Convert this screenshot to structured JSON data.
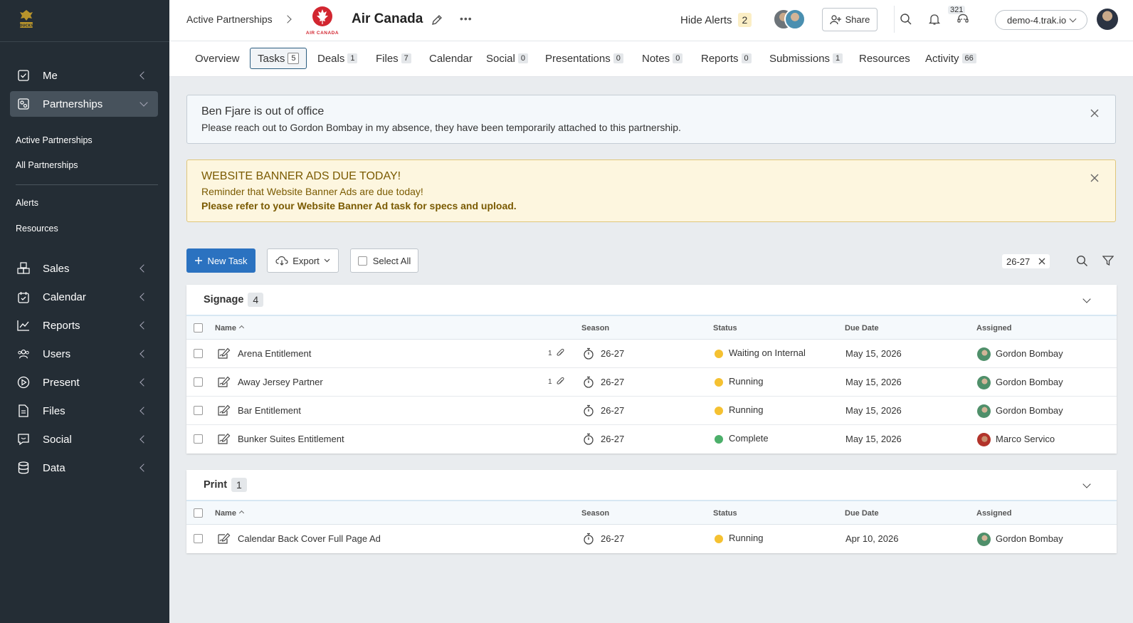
{
  "sidebar": {
    "logo_text": "DUCKS",
    "items": [
      {
        "label": "Me",
        "icon": "check-square-icon"
      },
      {
        "label": "Partnerships",
        "icon": "partnership-icon"
      },
      {
        "label": "Sales",
        "icon": "boxes-icon"
      },
      {
        "label": "Calendar",
        "icon": "calendar-check-icon"
      },
      {
        "label": "Reports",
        "icon": "chart-icon"
      },
      {
        "label": "Users",
        "icon": "users-icon"
      },
      {
        "label": "Present",
        "icon": "play-icon"
      },
      {
        "label": "Files",
        "icon": "file-icon"
      },
      {
        "label": "Social",
        "icon": "chat-icon"
      },
      {
        "label": "Data",
        "icon": "database-icon"
      }
    ],
    "subitems": {
      "active_partnerships": "Active Partnerships",
      "all_partnerships": "All Partnerships",
      "alerts": "Alerts",
      "resources": "Resources"
    }
  },
  "topbar": {
    "breadcrumb": "Active Partnerships",
    "logo_text": "AIR CANADA",
    "title": "Air Canada",
    "hide_alerts_label": "Hide Alerts",
    "hide_alerts_count": "2",
    "share_label": "Share",
    "notifications_count": "321",
    "domain": "demo-4.trak.io"
  },
  "tabs": [
    {
      "label": "Overview",
      "count": ""
    },
    {
      "label": "Tasks",
      "count": "5"
    },
    {
      "label": "Deals",
      "count": "1"
    },
    {
      "label": "Files",
      "count": "7"
    },
    {
      "label": "Calendar",
      "count": ""
    },
    {
      "label": "Social",
      "count": "0"
    },
    {
      "label": "Presentations",
      "count": "0"
    },
    {
      "label": "Notes",
      "count": "0"
    },
    {
      "label": "Reports",
      "count": "0"
    },
    {
      "label": "Submissions",
      "count": "1"
    },
    {
      "label": "Resources",
      "count": ""
    },
    {
      "label": "Activity",
      "count": "66"
    }
  ],
  "alerts": {
    "info": {
      "title": "Ben Fjare is out of office",
      "line": "Please reach out to Gordon Bombay in my absence, they have been temporarily attached to this partnership."
    },
    "warn": {
      "title": "WEBSITE BANNER ADS DUE TODAY!",
      "line1": "Reminder that Website Banner Ads are due today!",
      "line2": "Please refer to your Website Banner Ad task for specs and upload."
    }
  },
  "actions": {
    "new_task": "New Task",
    "export": "Export",
    "select_all": "Select All",
    "filter_chip": "26-27"
  },
  "columns": {
    "name": "Name",
    "season": "Season",
    "status": "Status",
    "due": "Due Date",
    "assigned": "Assigned"
  },
  "groups": [
    {
      "title": "Signage",
      "count": "4",
      "rows": [
        {
          "name": "Arena Entitlement",
          "attachments": "1",
          "season": "26-27",
          "status": "Waiting on Internal",
          "status_color": "#f5c131",
          "due": "May 15, 2026",
          "assigned": "Gordon Bombay"
        },
        {
          "name": "Away Jersey Partner",
          "attachments": "1",
          "season": "26-27",
          "status": "Running",
          "status_color": "#f5c131",
          "due": "May 15, 2026",
          "assigned": "Gordon Bombay"
        },
        {
          "name": "Bar Entitlement",
          "attachments": "",
          "season": "26-27",
          "status": "Running",
          "status_color": "#f5c131",
          "due": "May 15, 2026",
          "assigned": "Gordon Bombay"
        },
        {
          "name": "Bunker Suites Entitlement",
          "attachments": "",
          "season": "26-27",
          "status": "Complete",
          "status_color": "#4caf6a",
          "due": "May 15, 2026",
          "assigned": "Marco Servico"
        }
      ]
    },
    {
      "title": "Print",
      "count": "1",
      "rows": [
        {
          "name": "Calendar Back Cover Full Page Ad",
          "attachments": "",
          "season": "26-27",
          "status": "Running",
          "status_color": "#f5c131",
          "due": "Apr 10, 2026",
          "assigned": "Gordon Bombay"
        }
      ]
    }
  ],
  "colors": {
    "sidebar_bg": "#242d35",
    "primary": "#2b72c0",
    "brand_red": "#d22630",
    "warn_bg": "#fdf6df",
    "warn_text": "#7a5a00"
  }
}
